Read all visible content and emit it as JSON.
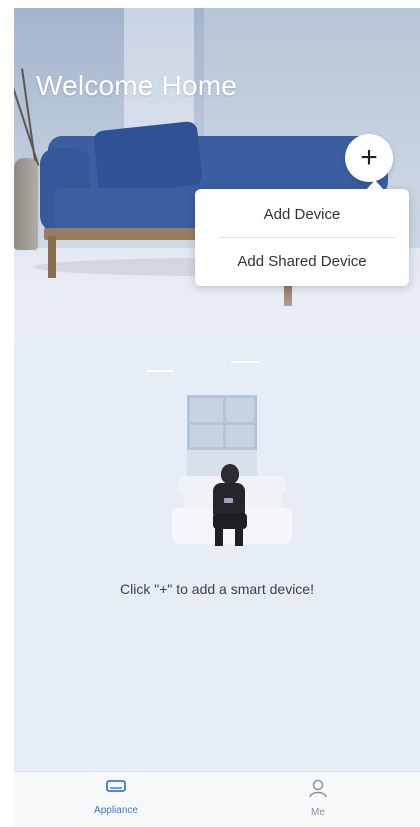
{
  "header": {
    "title": "Welcome Home",
    "add_button_symbol": "+"
  },
  "add_menu": {
    "items": [
      {
        "label": "Add Device"
      },
      {
        "label": "Add Shared Device"
      }
    ]
  },
  "empty_state": {
    "message": "Click \"+\" to add a smart device!"
  },
  "tabbar": {
    "tabs": [
      {
        "label": "Appliance",
        "icon": "appliance-icon",
        "active": true
      },
      {
        "label": "Me",
        "icon": "person-icon",
        "active": false
      }
    ]
  },
  "colors": {
    "accent": "#3a78d8",
    "inactive_tab": "#8d9198",
    "sofa": "#3a5ea0"
  }
}
